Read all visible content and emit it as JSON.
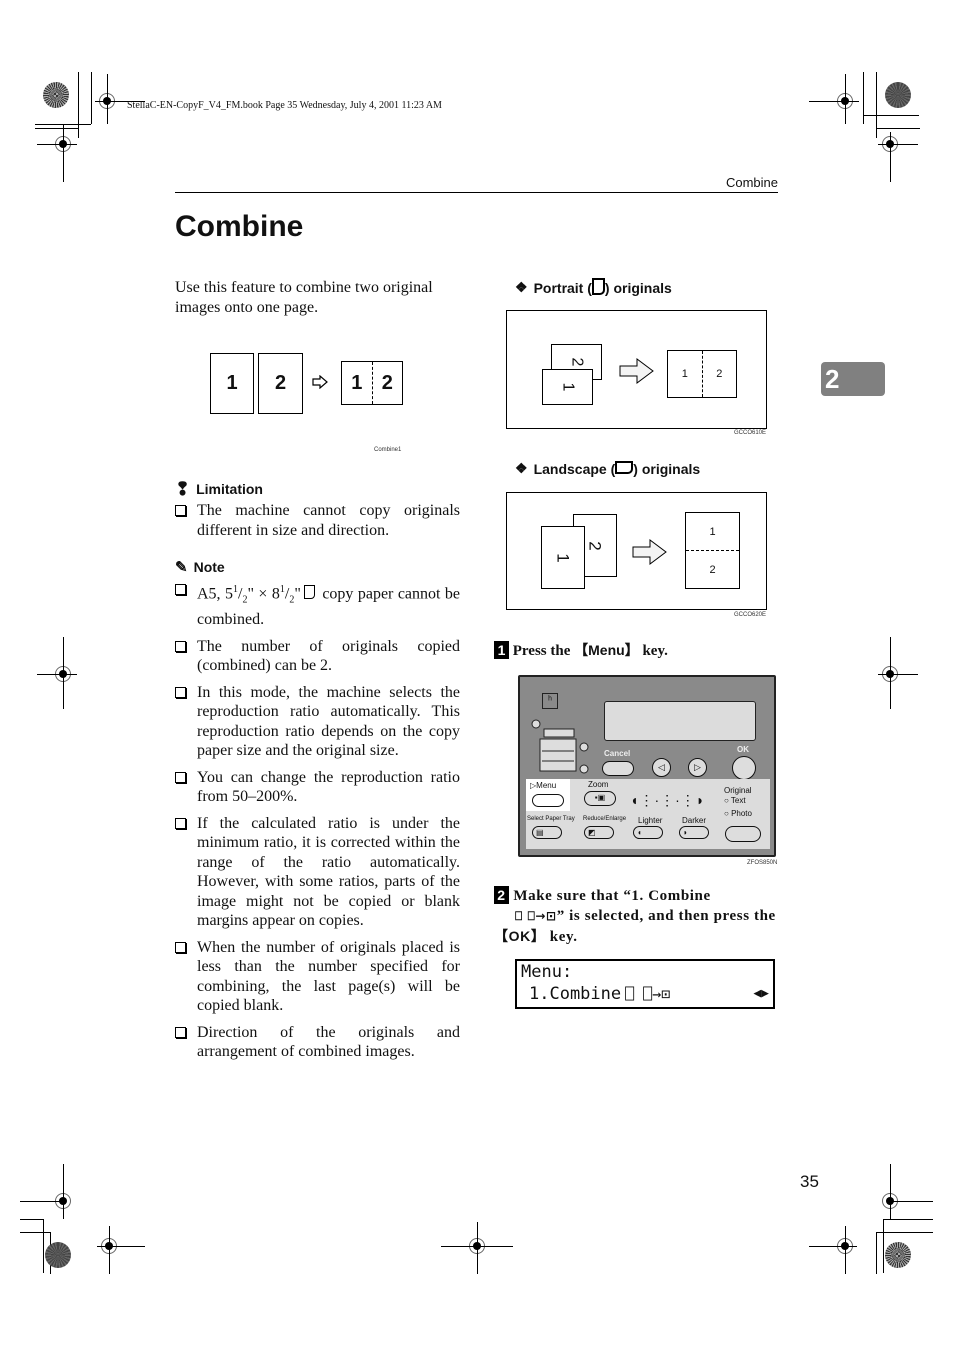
{
  "slug": "StellaC-EN-CopyF_V4_FM.book  Page 35  Wednesday, July 4, 2001  11:23 AM",
  "running_head": "Combine",
  "title": "Combine",
  "chapter_tab": "2",
  "page_number": "35",
  "intro": "Use this feature to combine two original images onto one page.",
  "intro_figure": {
    "originals": [
      "1",
      "2"
    ],
    "result": [
      "1",
      "2"
    ],
    "code": "Combine1"
  },
  "limitation": {
    "heading": "Limitation",
    "items": [
      "The machine cannot copy originals different in size and direction."
    ]
  },
  "note": {
    "heading": "Note",
    "items": [
      "copy paper cannot be combined.",
      "The number of originals copied (combined) can be 2.",
      "In this mode, the machine selects the reproduction ratio automatically. This reproduction ratio depends on the copy paper size and the original size.",
      "You can change the reproduction ratio from 50–200%.",
      "If the calculated ratio is under the minimum ratio, it is corrected within the range of the ratio automatically. However, with some ratios, parts of the image might not be copied or blank margins appear on copies.",
      "When the number of originals placed is less than the number specified for combining, the last page(s) will be copied blank.",
      "Direction of the originals and arrangement of combined images."
    ],
    "paper_size_prefix": "A5, 5",
    "paper_sup": "1",
    "paper_sub": "2",
    "paper_mid": "\" × 8",
    "paper_end": "\""
  },
  "portrait": {
    "heading_pre": "Portrait (",
    "heading_post": ") originals",
    "originals": [
      "1",
      "2"
    ],
    "result": [
      "1",
      "2"
    ],
    "code": "GCCO610E"
  },
  "landscape": {
    "heading_pre": "Landscape (",
    "heading_post": ") originals",
    "originals": [
      "1",
      "2"
    ],
    "result": [
      "1",
      "2"
    ],
    "code": "GCCO620E"
  },
  "steps": [
    {
      "number": "1",
      "pre": "Press the ",
      "key": "Menu",
      "post": " key."
    },
    {
      "number": "2",
      "pre": "Make sure that “1. Combine",
      "mid": "” is selected, and then press the ",
      "key": "OK",
      "post": " key."
    }
  ],
  "control_panel": {
    "labels": {
      "cancel": "Cancel",
      "ok": "OK",
      "menu": "Menu",
      "zoom": "Zoom",
      "original": "Original",
      "text": "Text",
      "photo": "Photo",
      "select_paper_tray": "Select Paper Tray",
      "reduce_enlarge": "Reduce/Enlarge",
      "lighter": "Lighter",
      "darker": "Darker"
    },
    "code": "ZFOS850N"
  },
  "lcd": {
    "line1": "Menu:",
    "line2": "1.Combine"
  }
}
